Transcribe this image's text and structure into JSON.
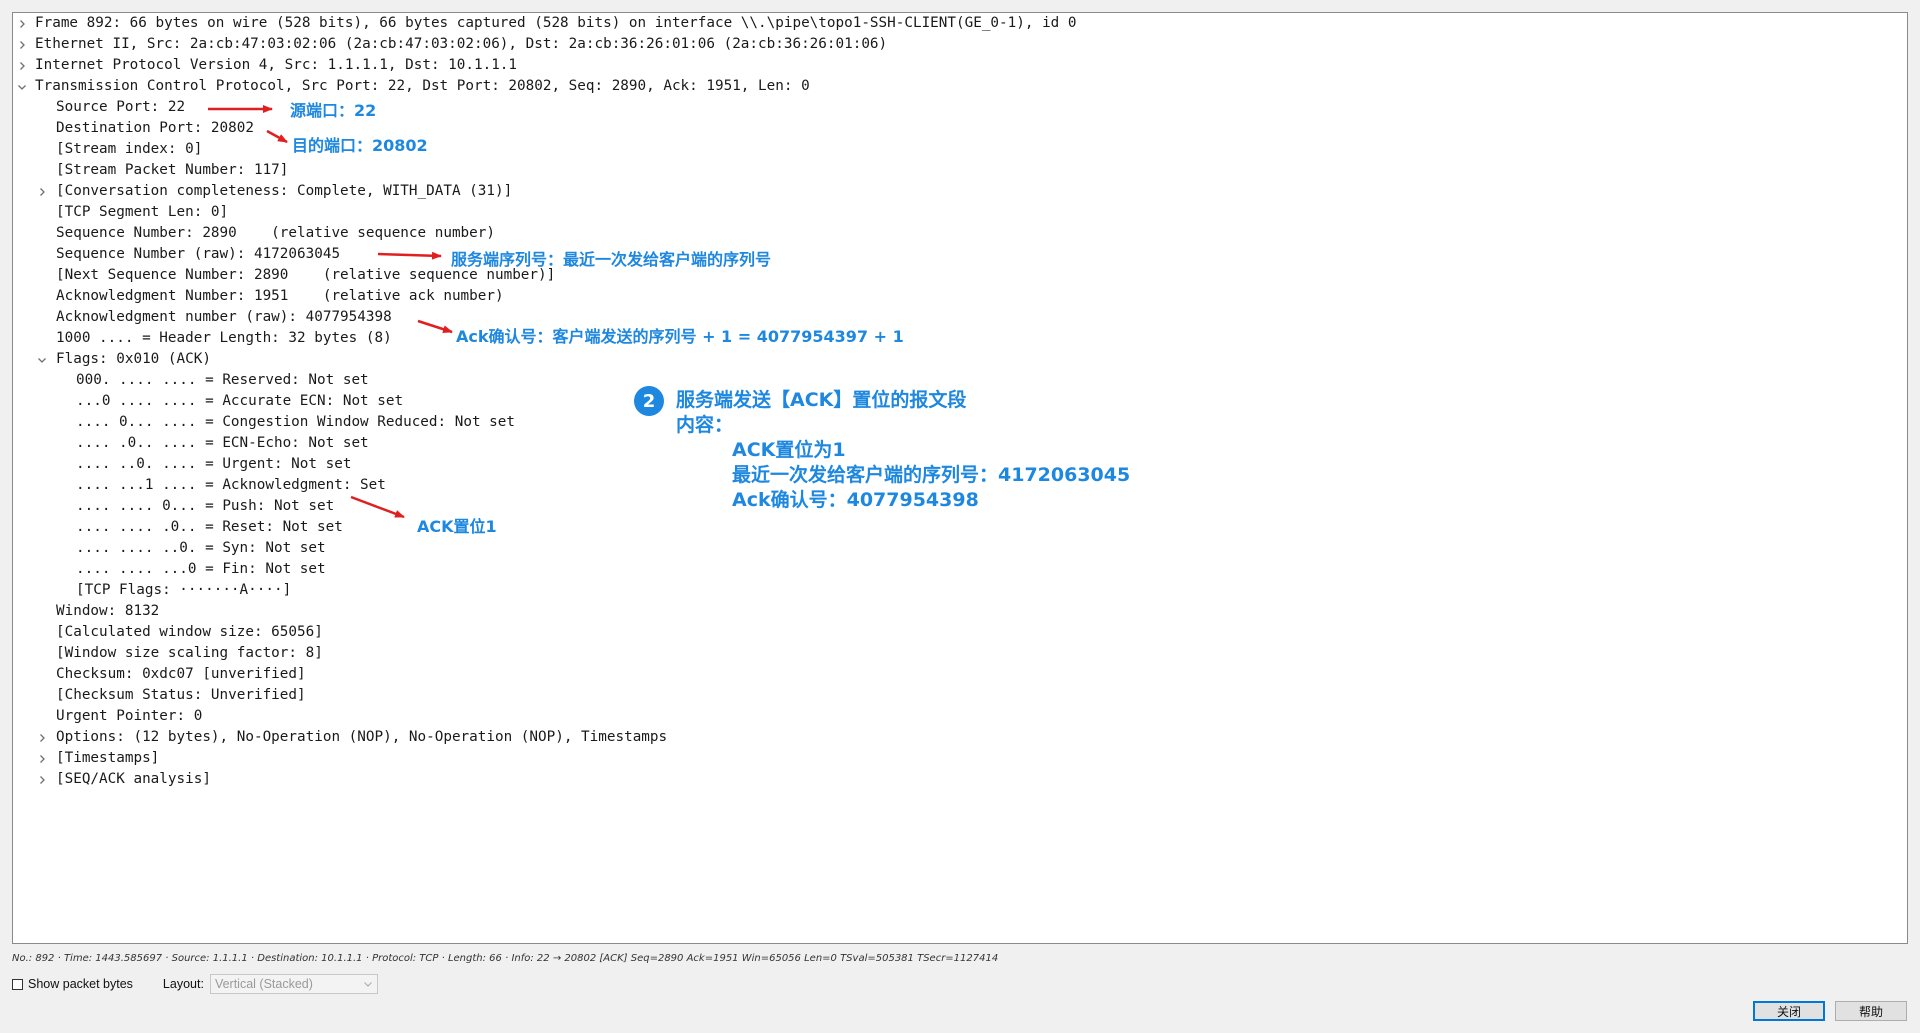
{
  "tree": {
    "rows": [
      {
        "text": "Frame 892: 66 bytes on wire (528 bits), 66 bytes captured (528 bits) on interface \\\\.\\pipe\\topo1-SSH-CLIENT(GE_0-1), id 0",
        "indent": 0,
        "expander": "collapsed"
      },
      {
        "text": "Ethernet II, Src: 2a:cb:47:03:02:06 (2a:cb:47:03:02:06), Dst: 2a:cb:36:26:01:06 (2a:cb:36:26:01:06)",
        "indent": 0,
        "expander": "collapsed"
      },
      {
        "text": "Internet Protocol Version 4, Src: 1.1.1.1, Dst: 10.1.1.1",
        "indent": 0,
        "expander": "collapsed"
      },
      {
        "text": "Transmission Control Protocol, Src Port: 22, Dst Port: 20802, Seq: 2890, Ack: 1951, Len: 0",
        "indent": 0,
        "expander": "expanded"
      },
      {
        "text": "Source Port: 22",
        "indent": 1,
        "expander": "none"
      },
      {
        "text": "Destination Port: 20802",
        "indent": 1,
        "expander": "none"
      },
      {
        "text": "[Stream index: 0]",
        "indent": 1,
        "expander": "none"
      },
      {
        "text": "[Stream Packet Number: 117]",
        "indent": 1,
        "expander": "none"
      },
      {
        "text": "[Conversation completeness: Complete, WITH_DATA (31)]",
        "indent": 1,
        "expander": "collapsed"
      },
      {
        "text": "[TCP Segment Len: 0]",
        "indent": 1,
        "expander": "none"
      },
      {
        "text": "Sequence Number: 2890    (relative sequence number)",
        "indent": 1,
        "expander": "none"
      },
      {
        "text": "Sequence Number (raw): 4172063045",
        "indent": 1,
        "expander": "none"
      },
      {
        "text": "[Next Sequence Number: 2890    (relative sequence number)]",
        "indent": 1,
        "expander": "none"
      },
      {
        "text": "Acknowledgment Number: 1951    (relative ack number)",
        "indent": 1,
        "expander": "none"
      },
      {
        "text": "Acknowledgment number (raw): 4077954398",
        "indent": 1,
        "expander": "none"
      },
      {
        "text": "1000 .... = Header Length: 32 bytes (8)",
        "indent": 1,
        "expander": "none"
      },
      {
        "text": "Flags: 0x010 (ACK)",
        "indent": 1,
        "expander": "expanded"
      },
      {
        "text": "000. .... .... = Reserved: Not set",
        "indent": 2,
        "expander": "none"
      },
      {
        "text": "...0 .... .... = Accurate ECN: Not set",
        "indent": 2,
        "expander": "none"
      },
      {
        "text": ".... 0... .... = Congestion Window Reduced: Not set",
        "indent": 2,
        "expander": "none"
      },
      {
        "text": ".... .0.. .... = ECN-Echo: Not set",
        "indent": 2,
        "expander": "none"
      },
      {
        "text": ".... ..0. .... = Urgent: Not set",
        "indent": 2,
        "expander": "none"
      },
      {
        "text": ".... ...1 .... = Acknowledgment: Set",
        "indent": 2,
        "expander": "none"
      },
      {
        "text": ".... .... 0... = Push: Not set",
        "indent": 2,
        "expander": "none"
      },
      {
        "text": ".... .... .0.. = Reset: Not set",
        "indent": 2,
        "expander": "none"
      },
      {
        "text": ".... .... ..0. = Syn: Not set",
        "indent": 2,
        "expander": "none"
      },
      {
        "text": ".... .... ...0 = Fin: Not set",
        "indent": 2,
        "expander": "none"
      },
      {
        "text": "[TCP Flags: ·······A····]",
        "indent": 2,
        "expander": "none"
      },
      {
        "text": "Window: 8132",
        "indent": 1,
        "expander": "none"
      },
      {
        "text": "[Calculated window size: 65056]",
        "indent": 1,
        "expander": "none"
      },
      {
        "text": "[Window size scaling factor: 8]",
        "indent": 1,
        "expander": "none"
      },
      {
        "text": "Checksum: 0xdc07 [unverified]",
        "indent": 1,
        "expander": "none"
      },
      {
        "text": "[Checksum Status: Unverified]",
        "indent": 1,
        "expander": "none"
      },
      {
        "text": "Urgent Pointer: 0",
        "indent": 1,
        "expander": "none"
      },
      {
        "text": "Options: (12 bytes), No-Operation (NOP), No-Operation (NOP), Timestamps",
        "indent": 1,
        "expander": "collapsed"
      },
      {
        "text": "[Timestamps]",
        "indent": 1,
        "expander": "collapsed"
      },
      {
        "text": "[SEQ/ACK analysis]",
        "indent": 1,
        "expander": "collapsed"
      }
    ]
  },
  "annotations": {
    "src_port": "源端口：22",
    "dst_port": "目的端口：20802",
    "seq_raw": "服务端序列号：最近一次发给客户端的序列号",
    "ack_raw": "Ack确认号：客户端发送的序列号 + 1 = 4077954397 + 1",
    "ack_flag": "ACK置位1",
    "step_number": "2",
    "summary_title": "服务端发送【ACK】置位的报文段",
    "summary_content_label": "内容：",
    "summary_line1": "ACK置位为1",
    "summary_line2": "最近一次发给客户端的序列号：4172063045",
    "summary_line3": "Ack确认号：4077954398",
    "color": "#1e87e0",
    "arrow_color": "#e02020"
  },
  "status_line": "No.: 892 · Time: 1443.585697 · Source: 1.1.1.1 · Destination: 10.1.1.1 · Protocol: TCP · Length: 66 · Info: 22 → 20802 [ACK] Seq=2890 Ack=1951 Win=65056 Len=0 TSval=505381 TSecr=1127414",
  "bottom": {
    "show_packet_bytes": "Show packet bytes",
    "layout_label": "Layout:",
    "layout_value": "Vertical (Stacked)",
    "close_button": "关闭",
    "help_button": "帮助"
  }
}
